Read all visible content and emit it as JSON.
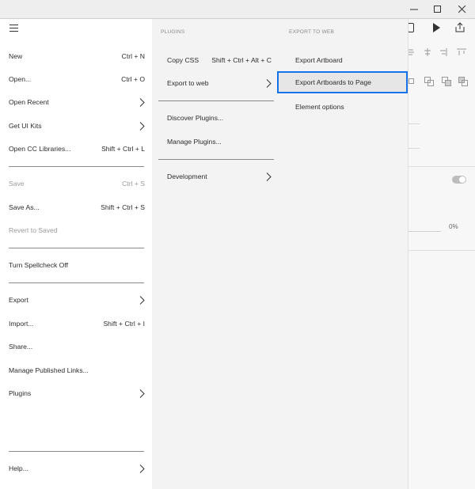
{
  "window": {
    "controls": [
      "minimize-icon",
      "maximize-icon",
      "close-icon"
    ]
  },
  "left_menu": {
    "items": [
      {
        "label": "New",
        "shortcut": "Ctrl + N"
      },
      {
        "label": "Open...",
        "shortcut": "Ctrl + O"
      },
      {
        "label": "Open Recent",
        "submenu": true
      },
      {
        "label": "Get UI Kits",
        "submenu": true
      },
      {
        "label": "Open CC Libraries...",
        "shortcut": "Shift + Ctrl + L"
      },
      {
        "label": "Save",
        "shortcut": "Ctrl + S",
        "disabled": true
      },
      {
        "label": "Save As...",
        "shortcut": "Shift + Ctrl + S"
      },
      {
        "label": "Revert to Saved",
        "disabled": true
      },
      {
        "label": "Turn Spellcheck Off"
      },
      {
        "label": "Export",
        "submenu": true
      },
      {
        "label": "Import...",
        "shortcut": "Shift + Ctrl + I"
      },
      {
        "label": "Share..."
      },
      {
        "label": "Manage Published Links..."
      },
      {
        "label": "Plugins",
        "submenu": true
      },
      {
        "label": "Help...",
        "submenu": true
      }
    ]
  },
  "plugins_panel": {
    "title": "PLUGINS",
    "items": [
      {
        "label": "Copy CSS",
        "shortcut": "Shift + Ctrl + Alt + C"
      },
      {
        "label": "Export to web",
        "submenu": true
      },
      {
        "label": "Discover Plugins..."
      },
      {
        "label": "Manage Plugins..."
      },
      {
        "label": "Development",
        "submenu": true
      }
    ]
  },
  "export_panel": {
    "title": "EXPORT TO WEB",
    "items": [
      {
        "label": "Export Artboard"
      },
      {
        "label": "Export Artboards to Page",
        "selected": true
      },
      {
        "label": "Element options"
      }
    ]
  },
  "background_app": {
    "opacity_value": "0%"
  },
  "colors": {
    "selection_border": "#1473e6",
    "selection_bg": "#e6e6e6",
    "panel_bg": "#f3f3f3"
  }
}
